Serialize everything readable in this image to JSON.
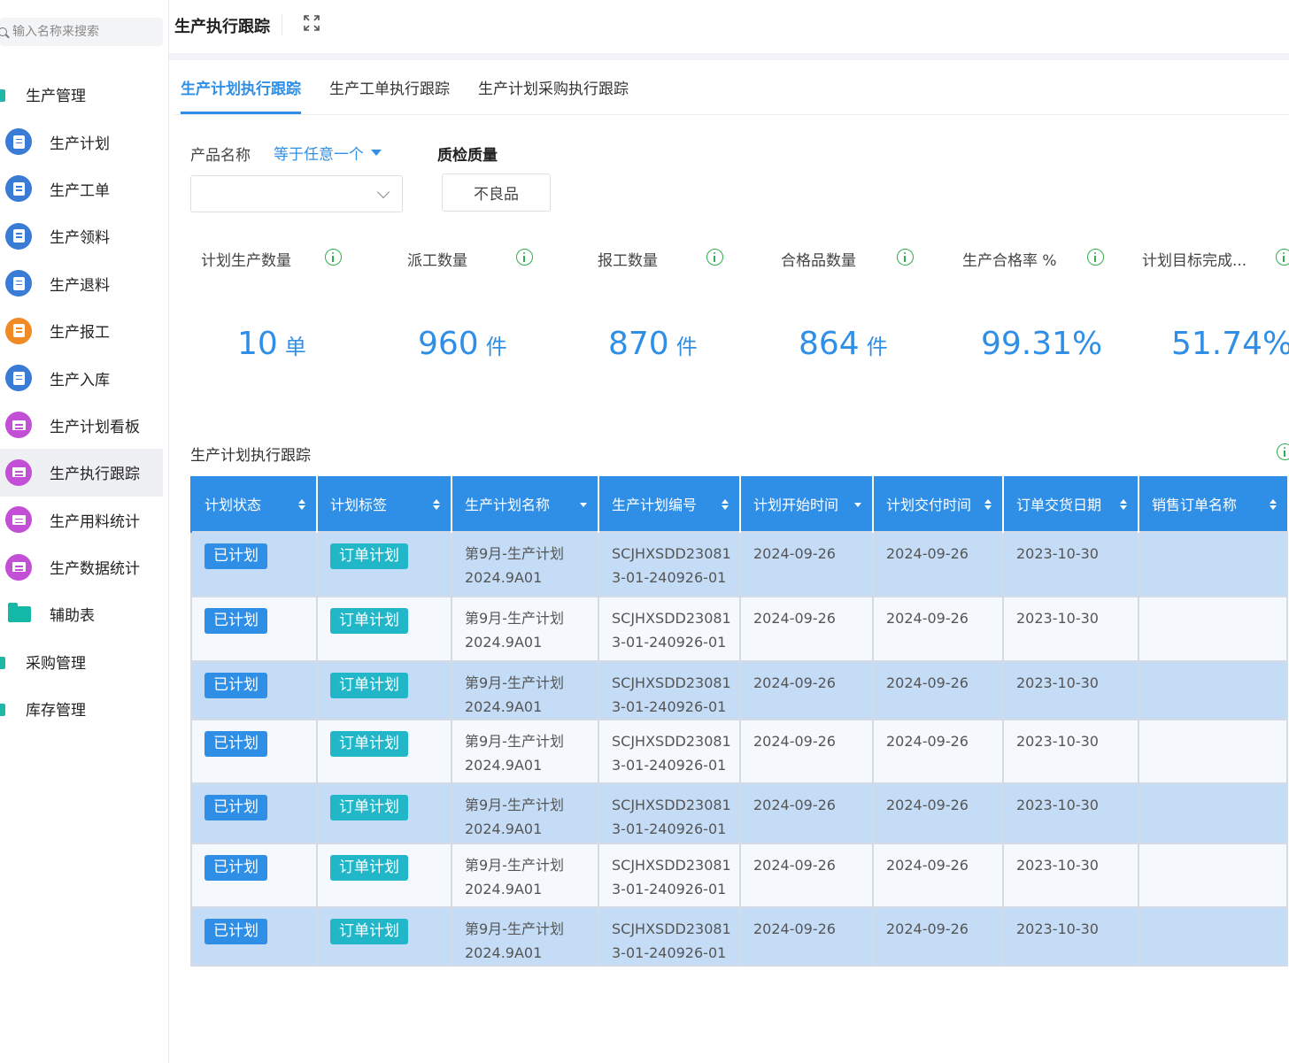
{
  "search": {
    "placeholder": "输入名称来搜索"
  },
  "sidebar": {
    "items": [
      {
        "label": "生产管理",
        "kind": "group"
      },
      {
        "label": "生产计划",
        "kind": "sub",
        "icon": "document-icon",
        "color": "#3a7bd5"
      },
      {
        "label": "生产工单",
        "kind": "sub",
        "icon": "document-icon",
        "color": "#3a7bd5"
      },
      {
        "label": "生产领料",
        "kind": "sub",
        "icon": "document-icon",
        "color": "#3a7bd5"
      },
      {
        "label": "生产退料",
        "kind": "sub",
        "icon": "document-icon",
        "color": "#3a7bd5"
      },
      {
        "label": "生产报工",
        "kind": "sub",
        "icon": "report-icon",
        "color": "#f08a24"
      },
      {
        "label": "生产入库",
        "kind": "sub",
        "icon": "document-icon",
        "color": "#3a7bd5"
      },
      {
        "label": "生产计划看板",
        "kind": "sub",
        "icon": "dashboard-icon",
        "color": "#c24fd6"
      },
      {
        "label": "生产执行跟踪",
        "kind": "sub",
        "icon": "dashboard-icon",
        "color": "#c24fd6"
      },
      {
        "label": "生产用料统计",
        "kind": "sub",
        "icon": "dashboard-icon",
        "color": "#c24fd6"
      },
      {
        "label": "生产数据统计",
        "kind": "sub",
        "icon": "dashboard-icon",
        "color": "#c24fd6"
      },
      {
        "label": "辅助表",
        "kind": "sub",
        "icon": "folder-icon",
        "color": "#14b8a6"
      },
      {
        "label": "采购管理",
        "kind": "group"
      },
      {
        "label": "库存管理",
        "kind": "group"
      }
    ]
  },
  "header": {
    "title": "生产执行跟踪"
  },
  "tabs": [
    "生产计划执行跟踪",
    "生产工单执行跟踪",
    "生产计划采购执行跟踪"
  ],
  "filters": {
    "product_label": "产品名称",
    "operator": "等于任意一个",
    "quality_label": "质检质量",
    "quality_value": "不良品"
  },
  "kpis": [
    {
      "label": "计划生产数量",
      "value": "10",
      "unit": "单"
    },
    {
      "label": "派工数量",
      "value": "960",
      "unit": "件"
    },
    {
      "label": "报工数量",
      "value": "870",
      "unit": "件"
    },
    {
      "label": "合格品数量",
      "value": "864",
      "unit": "件"
    },
    {
      "label": "生产合格率 %",
      "value": "99.31%",
      "unit": ""
    },
    {
      "label": "计划目标完成...",
      "value": "51.74%",
      "unit": ""
    }
  ],
  "table": {
    "title": "生产计划执行跟踪",
    "columns": [
      "计划状态",
      "计划标签",
      "生产计划名称",
      "生产计划编号",
      "计划开始时间",
      "计划交付时间",
      "订单交货日期",
      "销售订单名称"
    ],
    "rows": [
      {
        "status": "已计划",
        "tag": "订单计划",
        "name1": "第9月-生产计划",
        "name2": "2024.9A01",
        "code1": "SCJHXSDD23081",
        "code2": "3-01-240926-01",
        "start": "2024-09-26",
        "deliver": "2024-09-26",
        "order_date": "2023-10-30",
        "sales_order": ""
      },
      {
        "status": "已计划",
        "tag": "订单计划",
        "name1": "第9月-生产计划",
        "name2": "2024.9A01",
        "code1": "SCJHXSDD23081",
        "code2": "3-01-240926-01",
        "start": "2024-09-26",
        "deliver": "2024-09-26",
        "order_date": "2023-10-30",
        "sales_order": ""
      },
      {
        "status": "已计划",
        "tag": "订单计划",
        "name1": "第9月-生产计划",
        "name2": "2024.9A01",
        "code1": "SCJHXSDD23081",
        "code2": "3-01-240926-01",
        "start": "2024-09-26",
        "deliver": "2024-09-26",
        "order_date": "2023-10-30",
        "sales_order": ""
      },
      {
        "status": "已计划",
        "tag": "订单计划",
        "name1": "第9月-生产计划",
        "name2": "2024.9A01",
        "code1": "SCJHXSDD23081",
        "code2": "3-01-240926-01",
        "start": "2024-09-26",
        "deliver": "2024-09-26",
        "order_date": "2023-10-30",
        "sales_order": ""
      },
      {
        "status": "已计划",
        "tag": "订单计划",
        "name1": "第9月-生产计划",
        "name2": "2024.9A01",
        "code1": "SCJHXSDD23081",
        "code2": "3-01-240926-01",
        "start": "2024-09-26",
        "deliver": "2024-09-26",
        "order_date": "2023-10-30",
        "sales_order": ""
      },
      {
        "status": "已计划",
        "tag": "订单计划",
        "name1": "第9月-生产计划",
        "name2": "2024.9A01",
        "code1": "SCJHXSDD23081",
        "code2": "3-01-240926-01",
        "start": "2024-09-26",
        "deliver": "2024-09-26",
        "order_date": "2023-10-30",
        "sales_order": ""
      },
      {
        "status": "已计划",
        "tag": "订单计划",
        "name1": "第9月-生产计划",
        "name2": "2024.9A01",
        "code1": "SCJHXSDD23081",
        "code2": "3-01-240926-01",
        "start": "2024-09-26",
        "deliver": "2024-09-26",
        "order_date": "2023-10-30",
        "sales_order": ""
      }
    ]
  },
  "colors": {
    "accent": "#2f8fe6",
    "tag": "#21b7c9",
    "row_alt": "#c5dcf6",
    "info": "#2fae4e"
  }
}
